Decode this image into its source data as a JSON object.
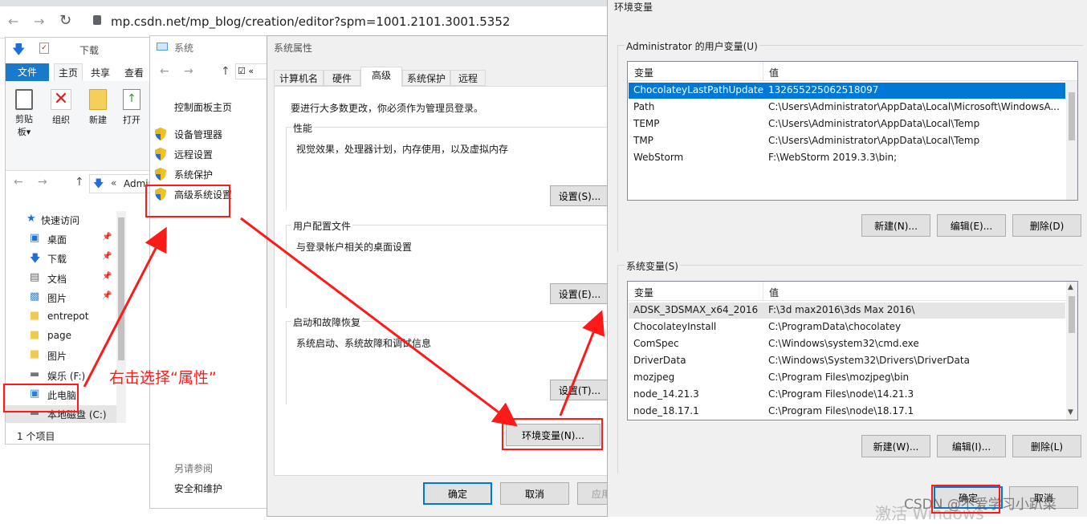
{
  "browser": {
    "address": "mp.csdn.net/mp_blog/creation/editor?spm=1001.2101.3001.5352"
  },
  "explorer": {
    "title": "下载",
    "ribbon_tabs": [
      "文件",
      "主页",
      "共享",
      "查看"
    ],
    "ribbon_buttons": [
      {
        "label": "剪贴板▾",
        "icon": "clipboard-icon"
      },
      {
        "label": "组织",
        "icon": "organize-icon"
      },
      {
        "label": "新建",
        "icon": "new-folder-icon"
      },
      {
        "label": "打开",
        "icon": "open-icon"
      }
    ],
    "path": "Admin",
    "nav": [
      {
        "label": "快速访问",
        "icon": "star-icon"
      },
      {
        "label": "桌面",
        "icon": "desktop-icon",
        "pin": true
      },
      {
        "label": "下载",
        "icon": "download-icon",
        "pin": true
      },
      {
        "label": "文档",
        "icon": "document-icon",
        "pin": true
      },
      {
        "label": "图片",
        "icon": "picture-icon",
        "pin": true
      },
      {
        "label": "entrepot",
        "icon": "folder-icon"
      },
      {
        "label": "page",
        "icon": "folder-icon"
      },
      {
        "label": "图片",
        "icon": "folder-icon"
      },
      {
        "label": "娱乐 (F:)",
        "icon": "drive-icon"
      },
      {
        "label": "此电脑",
        "icon": "computer-icon"
      },
      {
        "label": "本地磁盘 (C:)",
        "icon": "drive-icon"
      }
    ],
    "status": "1 个项目"
  },
  "annotation": {
    "text": "右击选择“属性”"
  },
  "system": {
    "title": "系统",
    "home": "控制面板主页",
    "links": [
      "设备管理器",
      "远程设置",
      "系统保护",
      "高级系统设置"
    ],
    "see_also": "另请参阅",
    "security": "安全和维护"
  },
  "props": {
    "title": "系统属性",
    "tabs": [
      "计算机名",
      "硬件",
      "高级",
      "系统保护",
      "远程"
    ],
    "notice": "要进行大多数更改，你必须作为管理员登录。",
    "groups": [
      {
        "title": "性能",
        "desc": "视觉效果，处理器计划，内存使用，以及虚拟内存",
        "button": "设置(S)..."
      },
      {
        "title": "用户配置文件",
        "desc": "与登录帐户相关的桌面设置",
        "button": "设置(E)..."
      },
      {
        "title": "启动和故障恢复",
        "desc": "系统启动、系统故障和调试信息",
        "button": "设置(T)..."
      }
    ],
    "env_button": "环境变量(N)...",
    "ok": "确定",
    "cancel": "取消",
    "apply": "应用"
  },
  "env": {
    "title": "环境变量",
    "user_group": "Administrator 的用户变量(U)",
    "col_var": "变量",
    "col_val": "值",
    "user_vars": [
      {
        "name": "ChocolateyLastPathUpdate",
        "value": "132655225062518097"
      },
      {
        "name": "Path",
        "value": "C:\\Users\\Administrator\\AppData\\Local\\Microsoft\\WindowsA..."
      },
      {
        "name": "TEMP",
        "value": "C:\\Users\\Administrator\\AppData\\Local\\Temp"
      },
      {
        "name": "TMP",
        "value": "C:\\Users\\Administrator\\AppData\\Local\\Temp"
      },
      {
        "name": "WebStorm",
        "value": "F:\\WebStorm 2019.3.3\\bin;"
      }
    ],
    "user_buttons": [
      "新建(N)...",
      "编辑(E)...",
      "删除(D)"
    ],
    "sys_group": "系统变量(S)",
    "sys_vars": [
      {
        "name": "ADSK_3DSMAX_x64_2016",
        "value": "F:\\3d max2016\\3ds Max 2016\\"
      },
      {
        "name": "ChocolateyInstall",
        "value": "C:\\ProgramData\\chocolatey"
      },
      {
        "name": "ComSpec",
        "value": "C:\\Windows\\system32\\cmd.exe"
      },
      {
        "name": "DriverData",
        "value": "C:\\Windows\\System32\\Drivers\\DriverData"
      },
      {
        "name": "mozjpeg",
        "value": "C:\\Program Files\\mozjpeg\\bin"
      },
      {
        "name": "node_14.21.3",
        "value": "C:\\Program Files\\node\\14.21.3"
      },
      {
        "name": "node_18.17.1",
        "value": "C:\\Program Files\\node\\18.17.1"
      }
    ],
    "sys_buttons": [
      "新建(W)...",
      "编辑(I)...",
      "删除(L)"
    ],
    "ok": "确定",
    "cancel": "取消"
  },
  "watermark": "CSDN @不爱学习小趴菜",
  "activation": "激活 Windows"
}
